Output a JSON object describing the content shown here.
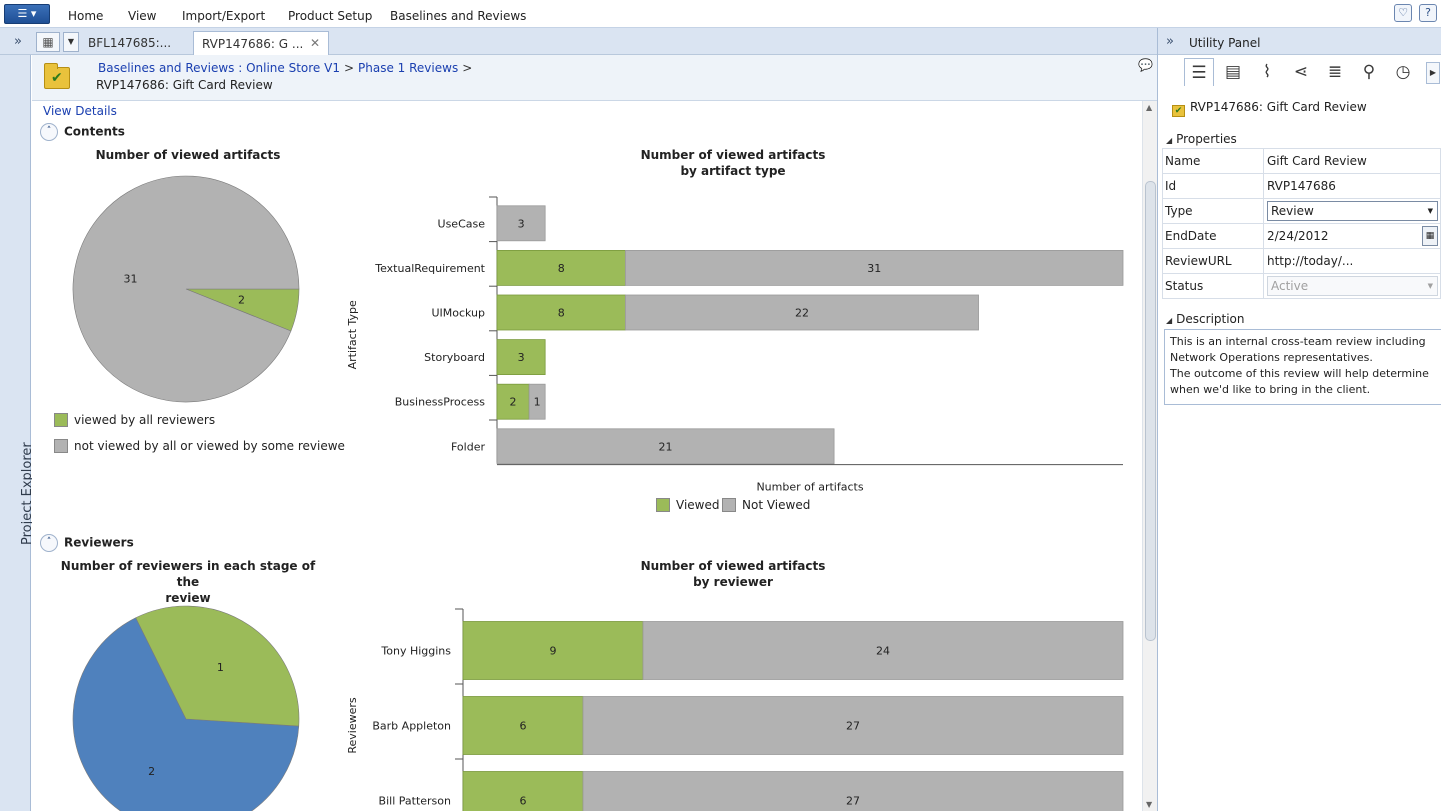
{
  "menu": {
    "app_button": "☰ ▾",
    "items": [
      "Home",
      "View",
      "Import/Export",
      "Product Setup",
      "Baselines and Reviews"
    ]
  },
  "tabs": {
    "collapse": "»",
    "items": [
      {
        "label": "BFL147685:..."
      },
      {
        "label": "RVP147686: G ..."
      }
    ],
    "close": "✕"
  },
  "left_rail": {
    "label": "Project Explorer"
  },
  "breadcrumb": {
    "links": [
      "Baselines and Reviews : Online Store V1",
      "Phase 1 Reviews"
    ],
    "separator": ">",
    "title": "RVP147686: Gift Card Review"
  },
  "main": {
    "view_details": "View Details",
    "contents_label": "Contents",
    "reviewers_label": "Reviewers",
    "toggle_icon": "˄"
  },
  "colors": {
    "viewed": "#9bbb59",
    "not_viewed": "#b2b2b2",
    "stage_blue": "#4f81bd"
  },
  "chart_data": [
    {
      "type": "pie",
      "title": "Number of viewed artifacts",
      "slices": [
        {
          "label": "viewed by all reviewers",
          "value": 2
        },
        {
          "label": "not viewed by all or viewed by some reviewe",
          "value": 31
        }
      ],
      "legend_position": "bottom"
    },
    {
      "type": "bar",
      "orientation": "horizontal",
      "stacked": true,
      "title_lines": [
        "Number of viewed artifacts",
        "by artifact type"
      ],
      "xlabel": "Number of artifacts",
      "ylabel": "Artifact Type",
      "categories": [
        "UseCase",
        "TextualRequirement",
        "UIMockup",
        "Storyboard",
        "BusinessProcess",
        "Folder"
      ],
      "series": [
        {
          "name": "Viewed",
          "values": [
            0,
            8,
            8,
            3,
            2,
            0
          ]
        },
        {
          "name": "Not Viewed",
          "values": [
            3,
            31,
            22,
            0,
            1,
            21
          ]
        }
      ],
      "legend_position": "bottom"
    },
    {
      "type": "pie",
      "title_lines": [
        "Number of reviewers in each stage of the",
        "review"
      ],
      "slices": [
        {
          "value": 2
        },
        {
          "value": 1
        }
      ]
    },
    {
      "type": "bar",
      "orientation": "horizontal",
      "stacked": true,
      "title_lines": [
        "Number of viewed artifacts",
        "by reviewer"
      ],
      "ylabel": "Reviewers",
      "categories": [
        "Tony Higgins",
        "Barb Appleton",
        "Bill Patterson"
      ],
      "series": [
        {
          "values": [
            9,
            6,
            6
          ]
        },
        {
          "values": [
            24,
            27,
            27
          ]
        }
      ]
    }
  ],
  "utility": {
    "collapse": "»",
    "title": "Utility Panel",
    "tab_icons": [
      "details-icon",
      "comments-icon",
      "attachments-icon",
      "relationships-icon",
      "outline-icon",
      "search-icon",
      "history-icon"
    ],
    "item_title": "RVP147686: Gift Card Review",
    "properties_label": "Properties",
    "description_label": "Description",
    "properties": [
      {
        "key": "Name",
        "value": "Gift Card Review"
      },
      {
        "key": "Id",
        "value": "RVP147686"
      },
      {
        "key": "Type",
        "value": "Review"
      },
      {
        "key": "EndDate",
        "value": "2/24/2012"
      },
      {
        "key": "ReviewURL",
        "value": "http://today/..."
      },
      {
        "key": "Status",
        "value": "Active"
      }
    ],
    "description_lines": [
      "This is an internal cross-team review including",
      "Network Operations representatives.",
      "The outcome of this review will help determine",
      "when we'd like to bring in the client."
    ]
  }
}
